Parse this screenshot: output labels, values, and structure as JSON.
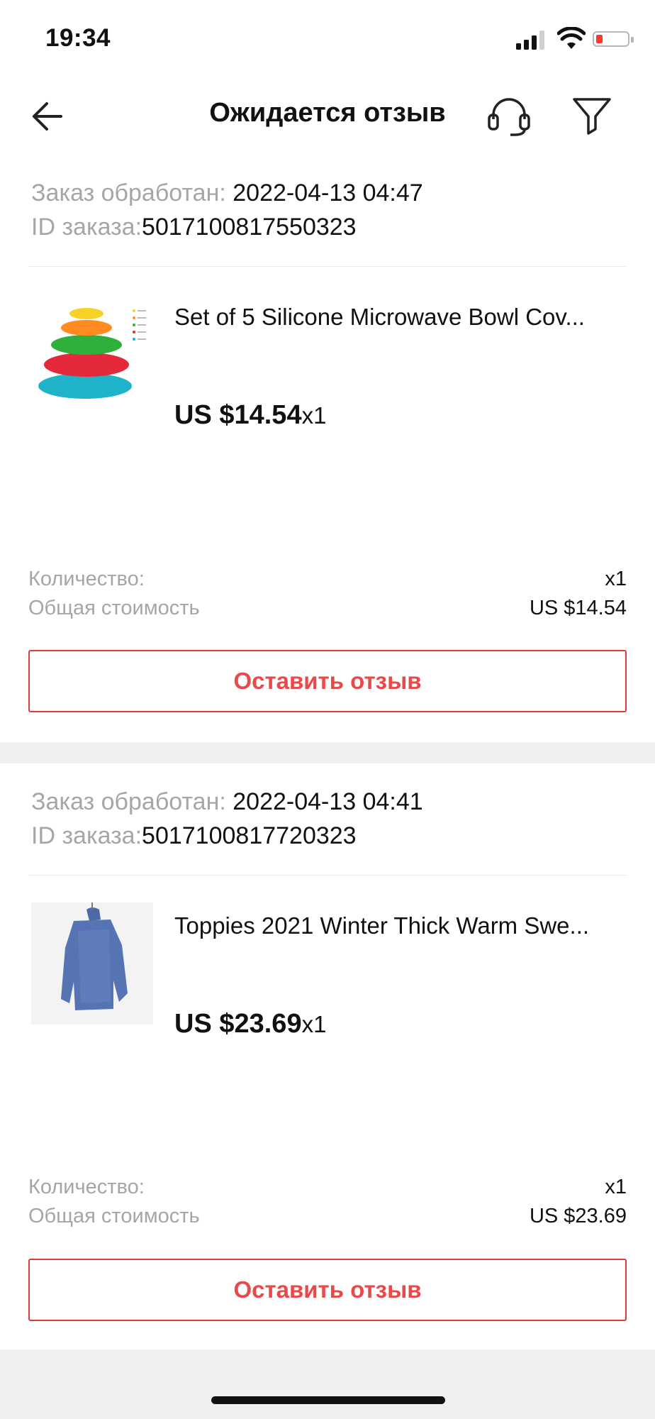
{
  "status_bar": {
    "time": "19:34"
  },
  "header": {
    "title": "Ожидается отзыв"
  },
  "colors": {
    "accent": "#e84a4a",
    "muted_text": "#a6a6a6",
    "battery_low": "#ff3b30"
  },
  "icons": {
    "back": "arrow-left-icon",
    "support": "headset-icon",
    "filter": "filter-funnel-icon"
  },
  "orders": [
    {
      "processed_label": "Заказ обработан:",
      "processed_value": "2022-04-13 04:47",
      "id_label": "ID заказа:",
      "id_value": "5017100817550323",
      "product_title": "Set of 5 Silicone Microwave Bowl Cov...",
      "price": "US $14.54",
      "quantity_suffix": "x1",
      "qty_label": "Количество:",
      "qty_value": "x1",
      "total_label": "Общая стоимость",
      "total_value": "US $14.54",
      "review_button": "Оставить отзыв"
    },
    {
      "processed_label": "Заказ обработан:",
      "processed_value": "2022-04-13 04:41",
      "id_label": "ID заказа:",
      "id_value": "5017100817720323",
      "product_title": "Toppies 2021 Winter Thick Warm Swe...",
      "price": "US $23.69",
      "quantity_suffix": "x1",
      "qty_label": "Количество:",
      "qty_value": "x1",
      "total_label": "Общая стоимость",
      "total_value": "US $23.69",
      "review_button": "Оставить отзыв"
    }
  ]
}
